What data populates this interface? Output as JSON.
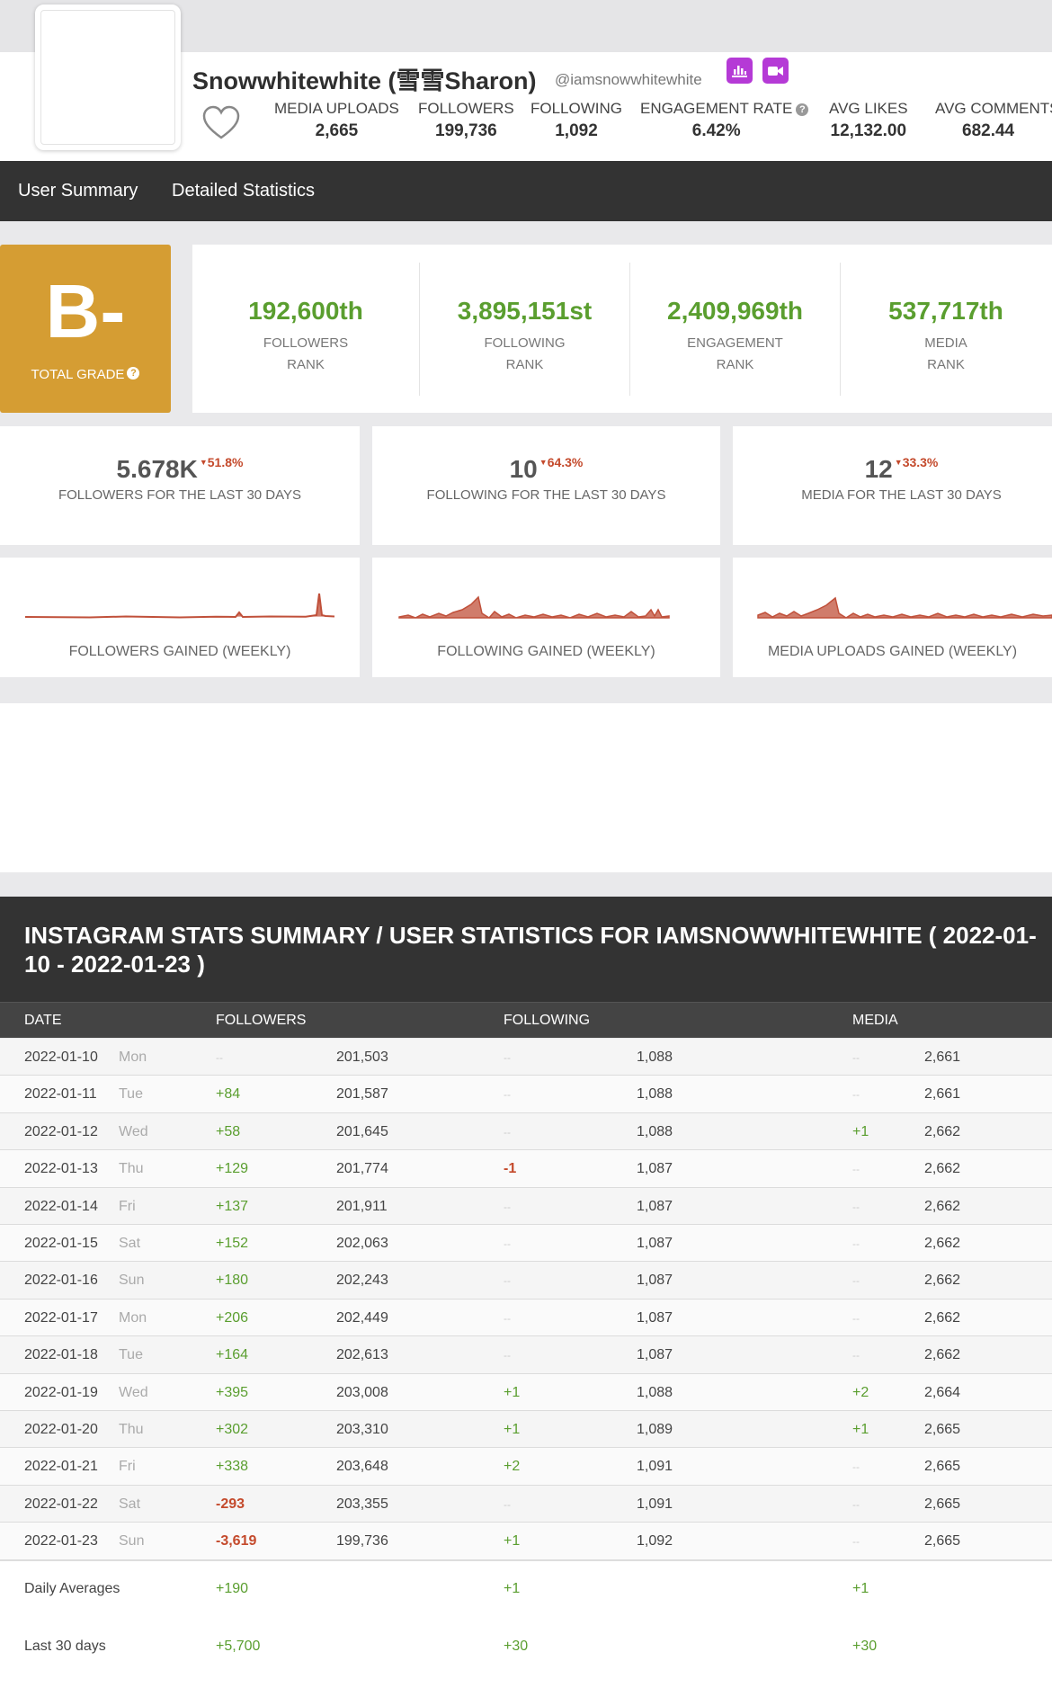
{
  "profile": {
    "name": "Snowwhitewhite (雪雪Sharon)",
    "handle": "@iamsnowwhitewhite",
    "stats": [
      {
        "label": "MEDIA UPLOADS",
        "value": "2,665"
      },
      {
        "label": "FOLLOWERS",
        "value": "199,736"
      },
      {
        "label": "FOLLOWING",
        "value": "1,092"
      },
      {
        "label": "ENGAGEMENT RATE",
        "value": "6.42%"
      },
      {
        "label": "AVG LIKES",
        "value": "12,132.00"
      },
      {
        "label": "AVG COMMENTS",
        "value": "682.44"
      }
    ],
    "icons": {
      "heart": "heart-icon",
      "chart": "bar-chart-icon",
      "video": "video-icon",
      "help": "?"
    }
  },
  "nav": {
    "items": [
      "User Summary",
      "Detailed Statistics"
    ]
  },
  "grade": {
    "letter": "B-",
    "label": "TOTAL GRADE",
    "color": "#d59d33"
  },
  "ranks": [
    {
      "value": "192,600th",
      "label1": "FOLLOWERS",
      "label2": "RANK"
    },
    {
      "value": "3,895,151st",
      "label1": "FOLLOWING",
      "label2": "RANK"
    },
    {
      "value": "2,409,969th",
      "label1": "ENGAGEMENT",
      "label2": "RANK"
    },
    {
      "value": "537,717th",
      "label1": "MEDIA",
      "label2": "RANK"
    }
  ],
  "last30": [
    {
      "value": "5.678K",
      "change": "51.8%",
      "label": "FOLLOWERS FOR THE LAST 30 DAYS"
    },
    {
      "value": "10",
      "change": "64.3%",
      "label": "FOLLOWING FOR THE LAST 30 DAYS"
    },
    {
      "value": "12",
      "change": "33.3%",
      "label": "MEDIA FOR THE LAST 30 DAYS"
    }
  ],
  "sparklines": [
    {
      "label": "FOLLOWERS GAINED (WEEKLY)"
    },
    {
      "label": "FOLLOWING GAINED (WEEKLY)"
    },
    {
      "label": "MEDIA UPLOADS GAINED (WEEKLY)"
    }
  ],
  "table": {
    "title": "INSTAGRAM STATS SUMMARY / USER STATISTICS FOR IAMSNOWWHITEWHITE ( 2022-01-10 - 2022-01-23 )",
    "headers": {
      "date": "DATE",
      "followers": "FOLLOWERS",
      "following": "FOLLOWING",
      "media": "MEDIA"
    },
    "rows": [
      {
        "date": "2022-01-10",
        "dow": "Mon",
        "fd": "--",
        "fv": "201,503",
        "gd": "--",
        "gv": "1,088",
        "md": "--",
        "mv": "2,661"
      },
      {
        "date": "2022-01-11",
        "dow": "Tue",
        "fd": "+84",
        "fv": "201,587",
        "gd": "--",
        "gv": "1,088",
        "md": "--",
        "mv": "2,661"
      },
      {
        "date": "2022-01-12",
        "dow": "Wed",
        "fd": "+58",
        "fv": "201,645",
        "gd": "--",
        "gv": "1,088",
        "md": "+1",
        "mv": "2,662"
      },
      {
        "date": "2022-01-13",
        "dow": "Thu",
        "fd": "+129",
        "fv": "201,774",
        "gd": "-1",
        "gv": "1,087",
        "md": "--",
        "mv": "2,662"
      },
      {
        "date": "2022-01-14",
        "dow": "Fri",
        "fd": "+137",
        "fv": "201,911",
        "gd": "--",
        "gv": "1,087",
        "md": "--",
        "mv": "2,662"
      },
      {
        "date": "2022-01-15",
        "dow": "Sat",
        "fd": "+152",
        "fv": "202,063",
        "gd": "--",
        "gv": "1,087",
        "md": "--",
        "mv": "2,662"
      },
      {
        "date": "2022-01-16",
        "dow": "Sun",
        "fd": "+180",
        "fv": "202,243",
        "gd": "--",
        "gv": "1,087",
        "md": "--",
        "mv": "2,662"
      },
      {
        "date": "2022-01-17",
        "dow": "Mon",
        "fd": "+206",
        "fv": "202,449",
        "gd": "--",
        "gv": "1,087",
        "md": "--",
        "mv": "2,662"
      },
      {
        "date": "2022-01-18",
        "dow": "Tue",
        "fd": "+164",
        "fv": "202,613",
        "gd": "--",
        "gv": "1,087",
        "md": "--",
        "mv": "2,662"
      },
      {
        "date": "2022-01-19",
        "dow": "Wed",
        "fd": "+395",
        "fv": "203,008",
        "gd": "+1",
        "gv": "1,088",
        "md": "+2",
        "mv": "2,664"
      },
      {
        "date": "2022-01-20",
        "dow": "Thu",
        "fd": "+302",
        "fv": "203,310",
        "gd": "+1",
        "gv": "1,089",
        "md": "+1",
        "mv": "2,665"
      },
      {
        "date": "2022-01-21",
        "dow": "Fri",
        "fd": "+338",
        "fv": "203,648",
        "gd": "+2",
        "gv": "1,091",
        "md": "--",
        "mv": "2,665"
      },
      {
        "date": "2022-01-22",
        "dow": "Sat",
        "fd": "-293",
        "fv": "203,355",
        "gd": "--",
        "gv": "1,091",
        "md": "--",
        "mv": "2,665"
      },
      {
        "date": "2022-01-23",
        "dow": "Sun",
        "fd": "-3,619",
        "fv": "199,736",
        "gd": "+1",
        "gv": "1,092",
        "md": "--",
        "mv": "2,665"
      }
    ],
    "footer": [
      {
        "label": "Daily Averages",
        "fd": "+190",
        "gd": "+1",
        "md": "+1"
      },
      {
        "label": "Last 30 days",
        "fd": "+5,700",
        "gd": "+30",
        "md": "+30"
      }
    ]
  },
  "colors": {
    "positive": "#5a9e2f",
    "negative": "#c44a2c",
    "rank": "#5a9e2f",
    "chart": "#c0503a",
    "nav": "#333333",
    "accent_icon": "#b53ad6"
  }
}
